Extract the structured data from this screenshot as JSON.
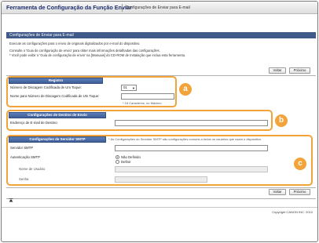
{
  "header": {
    "app_title": "Ferramenta de Configuração da Função Enviar",
    "page_crumb": "Configurações de Enviar para E-mail"
  },
  "section": {
    "title": "Configurações de Enviar para E-mail",
    "desc_line1": "Execute as configurações para o envio de originais digitalizados por e-mail do dispositivo.",
    "desc_line2": "Consulte o 'Guia de configuração de envio' para obter mais informações detalhadas das configurações.",
    "desc_line3": "* Você pode exibir o 'Guia de configuração de envio' na [Manuais] do CD-ROM de Instalação que inclua esta ferramenta."
  },
  "buttons": {
    "back": "Voltar",
    "next": "Próximo"
  },
  "registro": {
    "title": "Registro",
    "number_label": "Número de Discagem Codificada de Um Toque:",
    "number_value": "01",
    "name_label": "Nome para Número de Discagem Codificada de Um Toque:",
    "name_value": "",
    "name_hint": "* 16 Caracteres, no Máximo"
  },
  "destino": {
    "title": "Configurações de Destino de Envio",
    "email_label": "Endereço de E-mail de Destino:",
    "email_value": ""
  },
  "smtp": {
    "title": "Configurações de Servidor SMTP",
    "note": "* As Configurações do Servidor SMTP são configurações comuns a todos os usuários que usam o dispositivo.",
    "server_label": "Servidor SMTP",
    "server_value": "",
    "auth_label": "Autenticação SMTP",
    "opt_off": "Não Definido",
    "opt_on": "Definir",
    "user_label": "Nome de Usuário",
    "user_value": "",
    "password_label": "Senha",
    "password_value": ""
  },
  "callouts": {
    "a": "a",
    "b": "b",
    "c": "c"
  },
  "footer": {
    "top_icon": "up-arrow-icon",
    "copyright": "Copyright CANON INC. 2010"
  },
  "colors": {
    "accent": "#f2a33a",
    "header_bar": "#405a8a",
    "title_text": "#1d2f6e"
  }
}
